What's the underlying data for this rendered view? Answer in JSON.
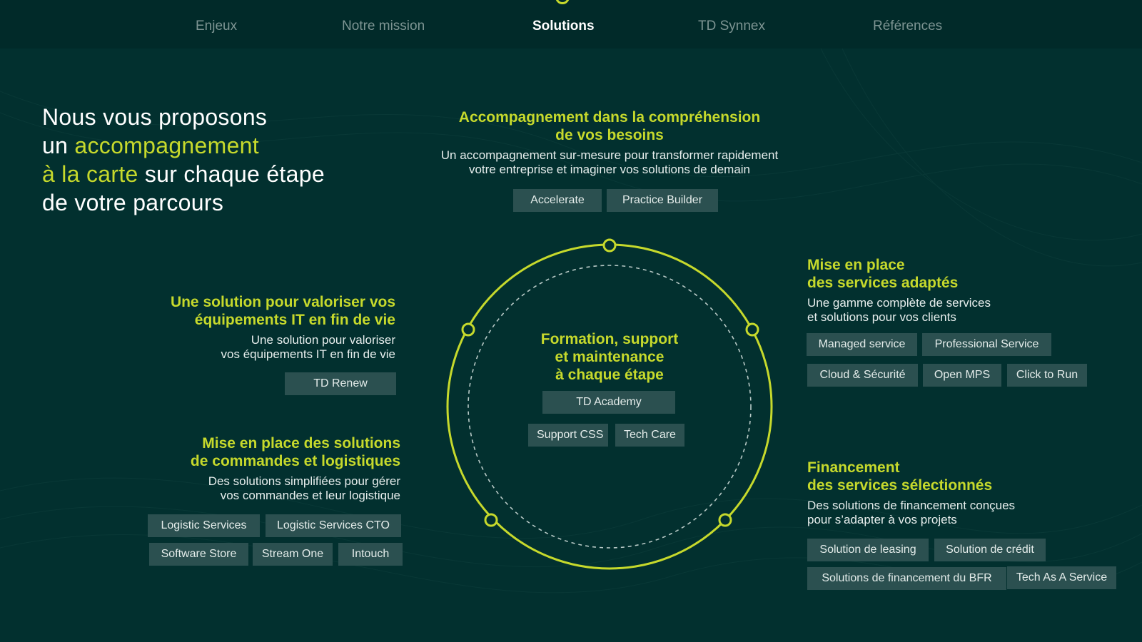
{
  "nav": {
    "items": [
      {
        "label": "Enjeux",
        "active": false
      },
      {
        "label": "Notre mission",
        "active": false
      },
      {
        "label": "Solutions",
        "active": true
      },
      {
        "label": "TD Synnex",
        "active": false
      },
      {
        "label": "Références",
        "active": false
      }
    ]
  },
  "headline": {
    "line1": "Nous vous proposons",
    "line2_prefix": "un ",
    "line2_highlight": "accompagnement",
    "line3_highlight": "à la carte",
    "line3_suffix": " sur chaque étape",
    "line4": "de votre parcours"
  },
  "blocks": {
    "top": {
      "title_line1": "Accompagnement dans la compréhension",
      "title_line2": "de vos besoins",
      "desc_line1": "Un accompagnement sur-mesure pour transformer rapidement",
      "desc_line2": "votre entreprise et imaginer vos solutions de demain",
      "tags": [
        "Accelerate",
        "Practice Builder"
      ]
    },
    "center": {
      "title_line1": "Formation, support",
      "title_line2": "et maintenance",
      "title_line3": "à chaque étape",
      "tags": [
        "TD Academy",
        "Support CSS",
        "Tech Care"
      ]
    },
    "right_top": {
      "title_line1": "Mise en place",
      "title_line2": "des services adaptés",
      "desc_line1": "Une gamme complète de services",
      "desc_line2": "et solutions pour vos clients",
      "tags": [
        "Managed service",
        "Professional Service",
        "Cloud & Sécurité",
        "Open MPS",
        "Click to Run"
      ]
    },
    "right_bottom": {
      "title_line1": "Financement",
      "title_line2": "des services sélectionnés",
      "desc_line1": "Des solutions de financement conçues",
      "desc_line2": "pour s’adapter à vos projets",
      "tags": [
        "Solution de leasing",
        "Solution de crédit",
        "Solutions de financement du BFR",
        "Tech As A Service"
      ]
    },
    "left_top": {
      "title_line1": "Une solution pour valoriser vos",
      "title_line2": "équipements IT en fin de vie",
      "desc_line1": "Une solution pour valoriser",
      "desc_line2": "vos équipements IT en fin de vie",
      "tags": [
        "TD Renew"
      ]
    },
    "left_bottom": {
      "title_line1": "Mise en place des solutions",
      "title_line2": "de commandes et logistiques",
      "desc_line1": "Des solutions simplifiées pour gérer",
      "desc_line2": "vos commandes et leur logistique",
      "tags": [
        "Logistic Services",
        "Logistic Services CTO",
        "Software Store",
        "Stream One",
        "Intouch"
      ]
    }
  },
  "colors": {
    "background": "#02302f",
    "nav_background": "#012a29",
    "accent": "#c6d92c",
    "tag_background": "#2b5050"
  }
}
